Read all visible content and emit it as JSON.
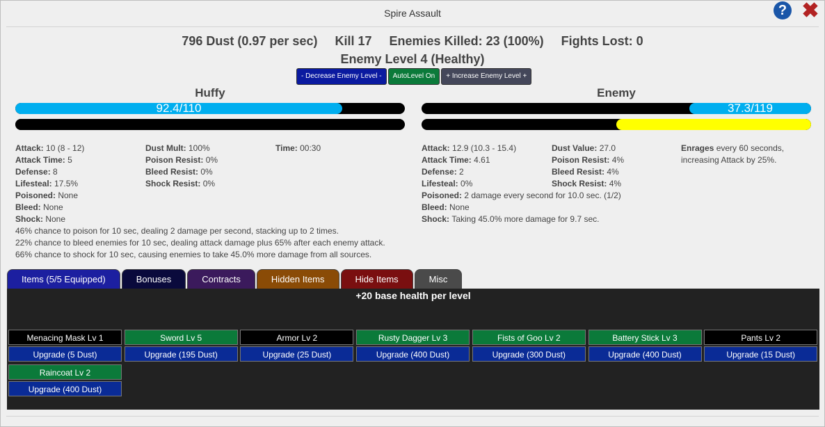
{
  "window": {
    "title": "Spire Assault"
  },
  "header": {
    "dust": "796 Dust (0.97 per sec)",
    "kill": "Kill 17",
    "enemies_killed": "Enemies Killed: 23 (100%)",
    "fights_lost": "Fights Lost: 0",
    "enemy_level": "Enemy Level 4 (Healthy)"
  },
  "level_buttons": {
    "decrease": "- Decrease Enemy Level -",
    "autolevel": "AutoLevel On",
    "increase": "+ Increase Enemy Level +"
  },
  "player": {
    "name": "Huffy",
    "health_text": "92.4/110",
    "health_fraction": 0.84,
    "attack_fraction": 1.0,
    "col1": [
      {
        "k": "Attack:",
        "v": "10 (8 - 12)"
      },
      {
        "k": "Attack Time:",
        "v": "5"
      },
      {
        "k": "Defense:",
        "v": "8"
      },
      {
        "k": "Lifesteal:",
        "v": "17.5%"
      },
      {
        "k": "Poisoned:",
        "v": "None"
      },
      {
        "k": "Bleed:",
        "v": "None"
      },
      {
        "k": "Shock:",
        "v": "None"
      }
    ],
    "col2": [
      {
        "k": "Dust Mult:",
        "v": "100%"
      },
      {
        "k": "Poison Resist:",
        "v": "0%"
      },
      {
        "k": "Bleed Resist:",
        "v": "0%"
      },
      {
        "k": "Shock Resist:",
        "v": "0%"
      }
    ],
    "col3": [
      {
        "k": "Time:",
        "v": "00:30"
      }
    ],
    "notes": [
      "46% chance to poison for 10 sec, dealing 2 damage per second, stacking up to 2 times.",
      "22% chance to bleed enemies for 10 sec, dealing attack damage plus 65% after each enemy attack.",
      "66% chance to shock for 10 sec, causing enemies to take 45.0% more damage from all sources."
    ]
  },
  "enemy": {
    "name": "Enemy",
    "health_text": "37.3/119",
    "health_fraction": 0.313,
    "attack_fraction": 0.5,
    "col1": [
      {
        "k": "Attack:",
        "v": "12.9 (10.3 - 15.4)"
      },
      {
        "k": "Attack Time:",
        "v": "4.61"
      },
      {
        "k": "Defense:",
        "v": "2"
      },
      {
        "k": "Lifesteal:",
        "v": "0%"
      },
      {
        "k": "Poisoned:",
        "v": "2 damage every second for 10.0 sec. (1/2)"
      },
      {
        "k": "Bleed:",
        "v": "None"
      },
      {
        "k": "Shock:",
        "v": "Taking 45.0% more damage for 9.7 sec."
      }
    ],
    "col2": [
      {
        "k": "Dust Value:",
        "v": "27.0"
      },
      {
        "k": "Poison Resist:",
        "v": "4%"
      },
      {
        "k": "Bleed Resist:",
        "v": "4%"
      },
      {
        "k": "Shock Resist:",
        "v": "4%"
      }
    ],
    "enrage_label": "Enrages",
    "enrage_text": "every 60 seconds, increasing Attack by 25%."
  },
  "tabs": [
    {
      "label": "Items (5/5 Equipped)",
      "color": "#1c1fa0"
    },
    {
      "label": "Bonuses",
      "color": "#0a0a3c"
    },
    {
      "label": "Contracts",
      "color": "#3b1a5c"
    },
    {
      "label": "Hidden Items",
      "color": "#8a4b06"
    },
    {
      "label": "Hide Items",
      "color": "#7a0f10"
    },
    {
      "label": "Misc",
      "color": "#4a4a4a"
    }
  ],
  "panel": {
    "title": "+20 base health per level"
  },
  "items": [
    {
      "name": "Menacing Mask Lv 1",
      "upgrade": "Upgrade (5 Dust)",
      "equipped": false
    },
    {
      "name": "Sword Lv 5",
      "upgrade": "Upgrade (195 Dust)",
      "equipped": true
    },
    {
      "name": "Armor Lv 2",
      "upgrade": "Upgrade (25 Dust)",
      "equipped": false
    },
    {
      "name": "Rusty Dagger Lv 3",
      "upgrade": "Upgrade (400 Dust)",
      "equipped": true
    },
    {
      "name": "Fists of Goo Lv 2",
      "upgrade": "Upgrade (300 Dust)",
      "equipped": true
    },
    {
      "name": "Battery Stick Lv 3",
      "upgrade": "Upgrade (400 Dust)",
      "equipped": true
    },
    {
      "name": "Pants Lv 2",
      "upgrade": "Upgrade (15 Dust)",
      "equipped": false
    },
    {
      "name": "Raincoat Lv 2",
      "upgrade": "Upgrade (400 Dust)",
      "equipped": true
    }
  ],
  "colors": {
    "health": "#00aeef",
    "enemy_attack": "#ffff00",
    "equipped": "#0b7a3a",
    "unequipped": "#000000",
    "upgrade": "#0a2b96"
  }
}
